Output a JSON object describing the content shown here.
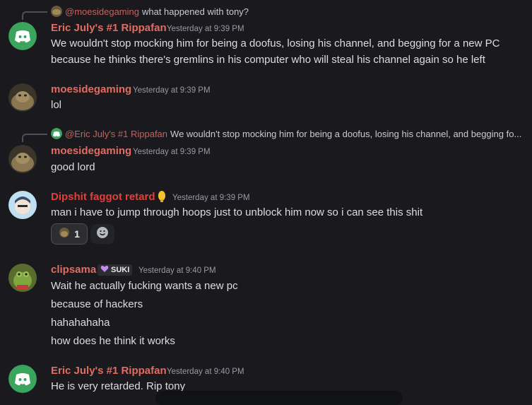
{
  "messages": [
    {
      "reply": {
        "name": "@moesidegaming",
        "text": "what happened with tony?"
      },
      "author": "Eric July's #1 Rippafan",
      "time": "Yesterday at 9:39 PM",
      "lines": [
        "We wouldn't stop mocking him for being a doofus, losing his channel, and begging for a new PC",
        "because he thinks there's gremlins in his computer who will steal his channel again so he left"
      ],
      "avatar": "discord-logo-icon"
    },
    {
      "author": "moesidegaming",
      "time": "Yesterday at 9:39 PM",
      "lines": [
        "lol"
      ],
      "avatar": "jabba-avatar"
    },
    {
      "reply": {
        "name": "@Eric July's #1 Rippafan",
        "text": "We wouldn't stop mocking him for being a doofus, losing his channel, and begging fo..."
      },
      "author": "moesidegaming",
      "time": "Yesterday at 9:39 PM",
      "lines": [
        "good lord"
      ],
      "avatar": "jabba-avatar"
    },
    {
      "author": "Dipshit faggot retard",
      "time": "Yesterday at 9:39 PM",
      "lines": [
        "man i have to jump through hoops just to unblock him now so i can see this shit"
      ],
      "avatar": "anime-avatar",
      "reaction": {
        "count": "1"
      }
    },
    {
      "author": "clipsama",
      "tag": "SUKI",
      "time": "Yesterday at 9:40 PM",
      "lines": [
        "Wait he actually fucking wants a new pc",
        "because of hackers",
        "hahahahaha",
        "how does he think it works"
      ],
      "avatar": "frog-avatar"
    },
    {
      "author": "Eric July's #1 Rippafan",
      "time": "Yesterday at 9:40 PM",
      "lines": [
        "He is very retarded. Rip tony"
      ],
      "avatar": "discord-logo-icon"
    }
  ],
  "colors": {
    "background": "#1a1a1e",
    "username": "#e06c62",
    "discord_blurple": "#3ba55d"
  }
}
